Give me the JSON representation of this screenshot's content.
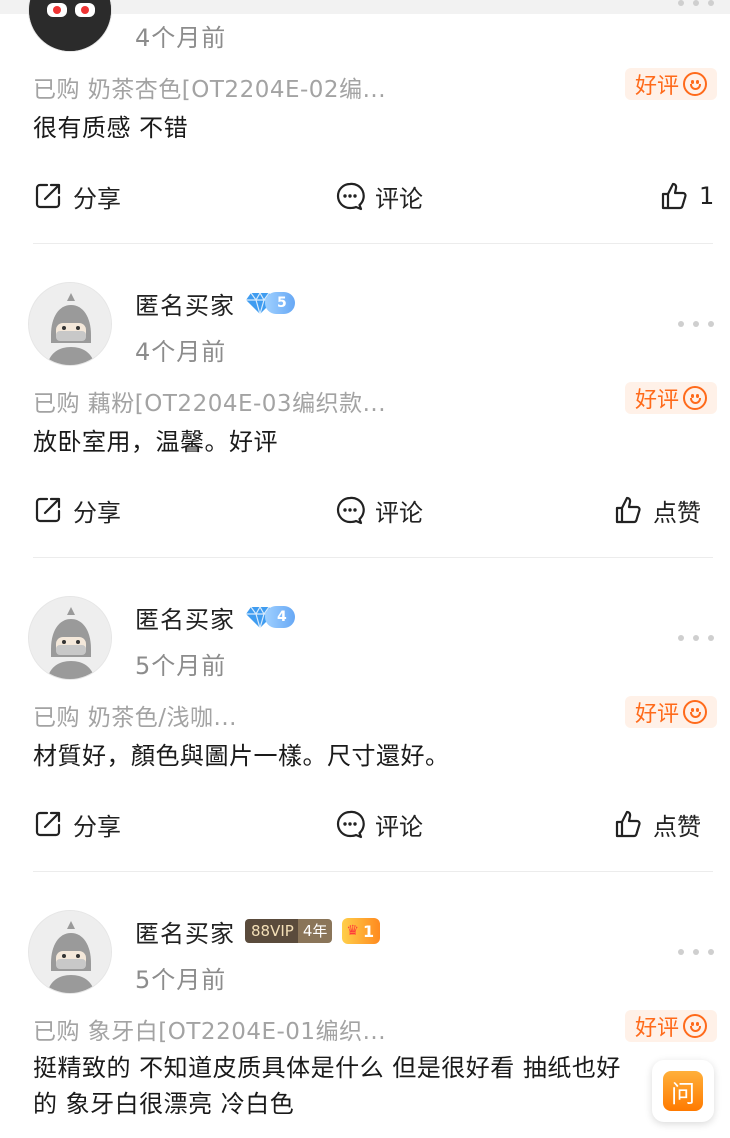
{
  "reviews": [
    {
      "time": "4个月前",
      "bought": "已购 奶茶杏色[OT2204E-02编...",
      "rating": "好评",
      "content": "很有质感 不错",
      "share": "分享",
      "comment": "评论",
      "like": "1"
    },
    {
      "name": "匿名买家",
      "badge_level": "5",
      "time": "4个月前",
      "bought": "已购 藕粉[OT2204E-03编织款...",
      "rating": "好评",
      "content": "放卧室用，温馨。好评",
      "share": "分享",
      "comment": "评论",
      "like": "点赞"
    },
    {
      "name": "匿名买家",
      "badge_level": "4",
      "time": "5个月前",
      "bought": "已购 奶茶色/浅咖...",
      "rating": "好评",
      "content": "材質好，顏色與圖片一樣。尺寸還好。",
      "share": "分享",
      "comment": "评论",
      "like": "点赞"
    },
    {
      "name": "匿名买家",
      "vip_label": "88VIP",
      "vip_years": "4年",
      "level": "1",
      "time": "5个月前",
      "bought": "已购 象牙白[OT2204E-01编织...",
      "rating": "好评",
      "content_line1": "挺精致的 不知道皮质具体是什么 但是很好看 抽纸也好",
      "content_line2": "的 象牙白很漂亮 冷白色"
    }
  ],
  "ask_button": "问",
  "colors": {
    "accent": "#ff6a1a",
    "diamond": "#67a8f5"
  },
  "icons": [
    "share-icon",
    "comment-icon",
    "like-icon",
    "more-icon",
    "smile-icon",
    "diamond-icon"
  ]
}
